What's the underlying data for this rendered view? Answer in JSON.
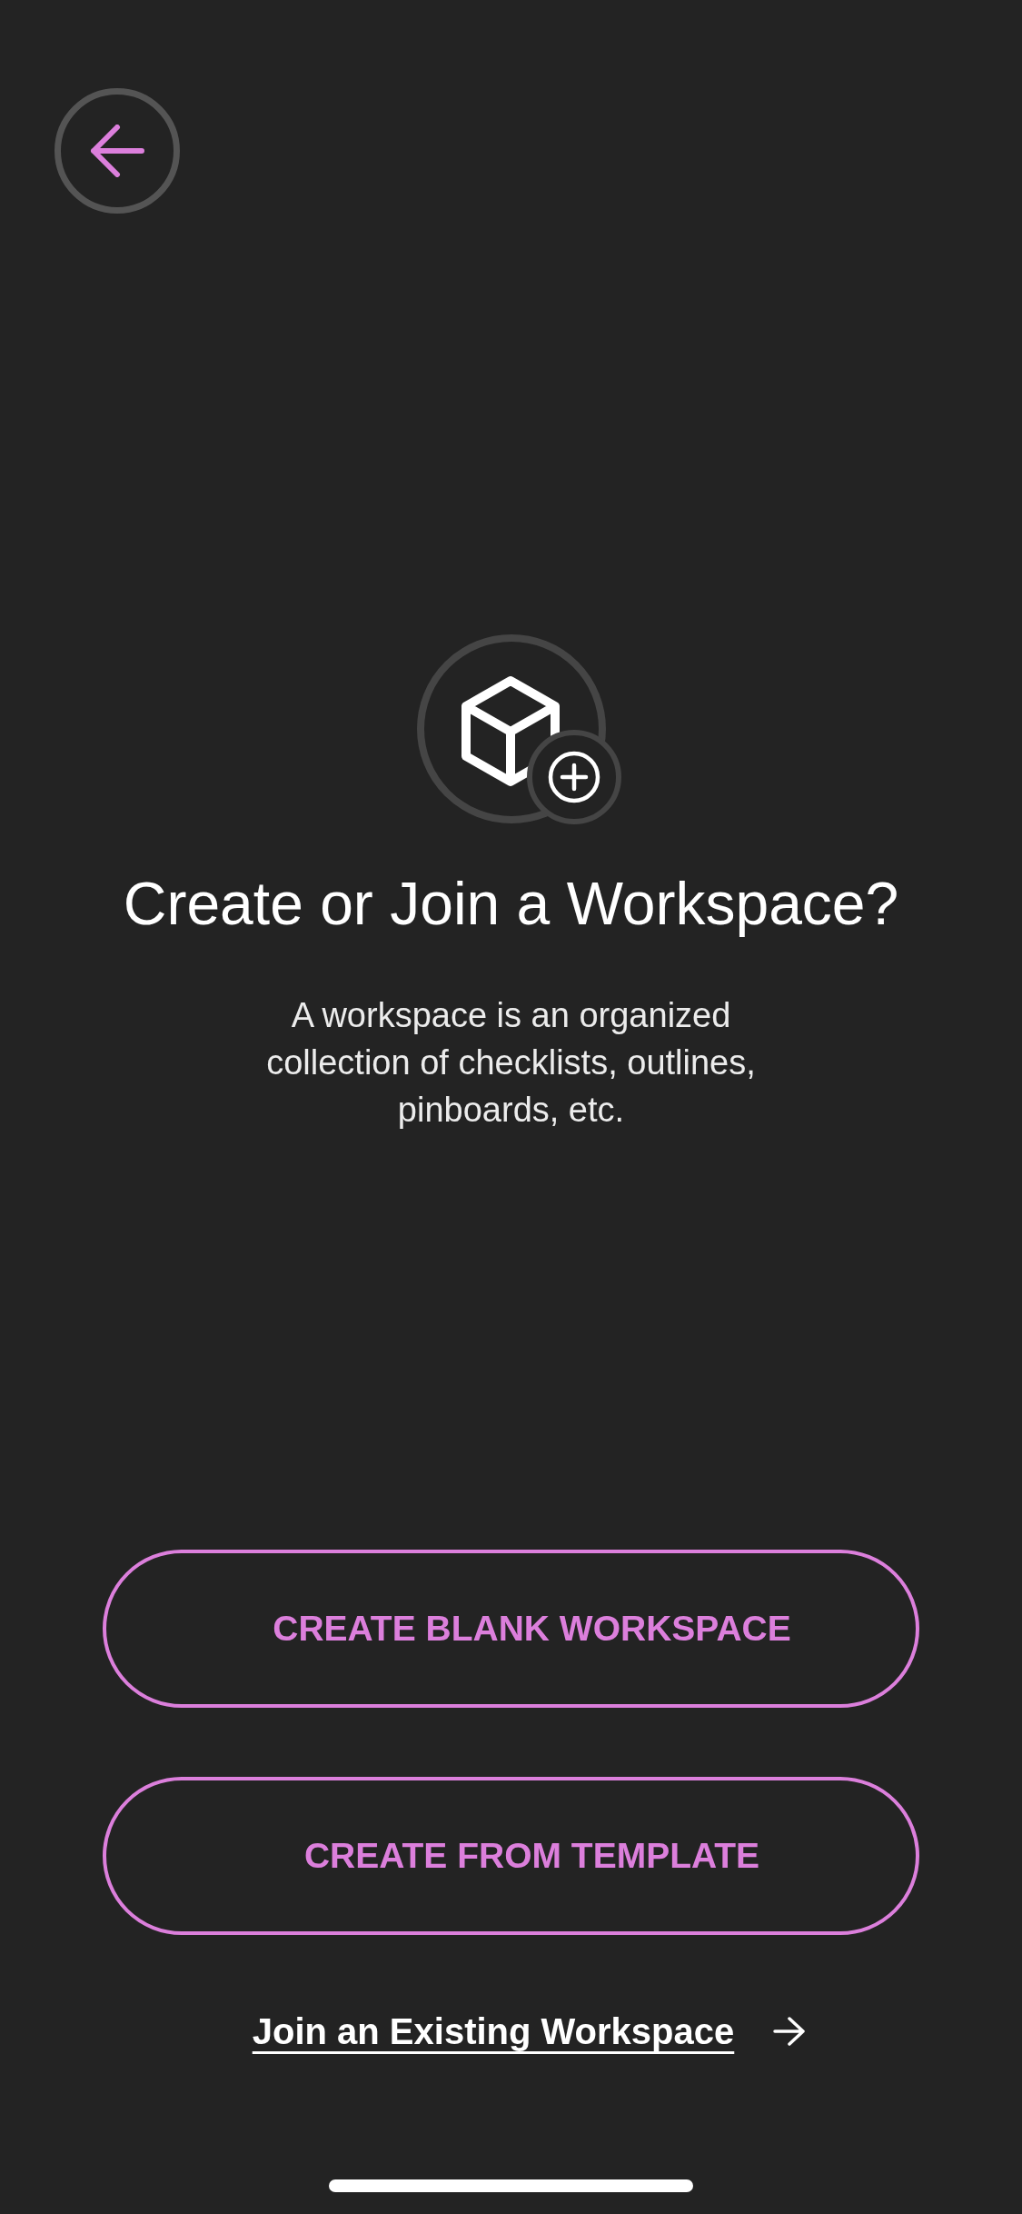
{
  "header": {
    "title": "Create or Join a Workspace?",
    "description": "A workspace is an organized collection of checklists, outlines, pinboards, etc."
  },
  "actions": [
    {
      "label": "CREATE BLANK WORKSPACE"
    },
    {
      "label": "CREATE FROM TEMPLATE"
    }
  ],
  "link": {
    "label": "Join an Existing Workspace"
  }
}
